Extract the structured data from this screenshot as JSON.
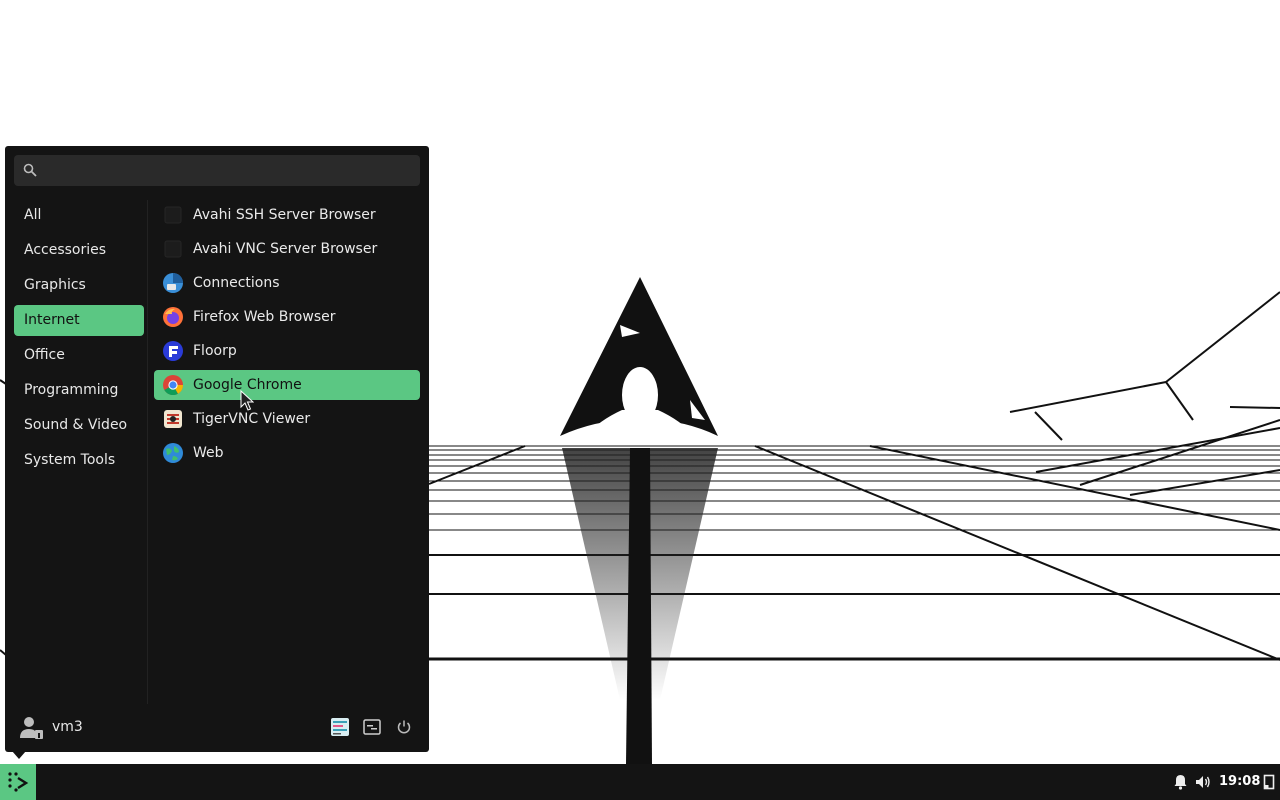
{
  "search": {
    "placeholder": "",
    "value": ""
  },
  "categories": [
    {
      "label": "All",
      "active": false
    },
    {
      "label": "Accessories",
      "active": false
    },
    {
      "label": "Graphics",
      "active": false
    },
    {
      "label": "Internet",
      "active": true
    },
    {
      "label": "Office",
      "active": false
    },
    {
      "label": "Programming",
      "active": false
    },
    {
      "label": "Sound & Video",
      "active": false
    },
    {
      "label": "System Tools",
      "active": false
    }
  ],
  "apps": [
    {
      "label": "Avahi SSH Server Browser",
      "icon": "avahi-ssh-icon",
      "active": false
    },
    {
      "label": "Avahi VNC Server Browser",
      "icon": "avahi-vnc-icon",
      "active": false
    },
    {
      "label": "Connections",
      "icon": "connections-icon",
      "active": false
    },
    {
      "label": "Firefox Web Browser",
      "icon": "firefox-icon",
      "active": false
    },
    {
      "label": "Floorp",
      "icon": "floorp-icon",
      "active": false
    },
    {
      "label": "Google Chrome",
      "icon": "chrome-icon",
      "active": true
    },
    {
      "label": "TigerVNC Viewer",
      "icon": "tigervnc-icon",
      "active": false
    },
    {
      "label": "Web",
      "icon": "web-globe-icon",
      "active": false
    }
  ],
  "user": {
    "name": "vm3"
  },
  "footer_buttons": [
    "settings-manager-icon",
    "lock-screen-icon",
    "power-icon"
  ],
  "taskbar": {
    "clock": "19:08"
  },
  "colors": {
    "accent": "#5bc783",
    "menu_bg": "#141414",
    "taskbar_bg": "#141414"
  }
}
